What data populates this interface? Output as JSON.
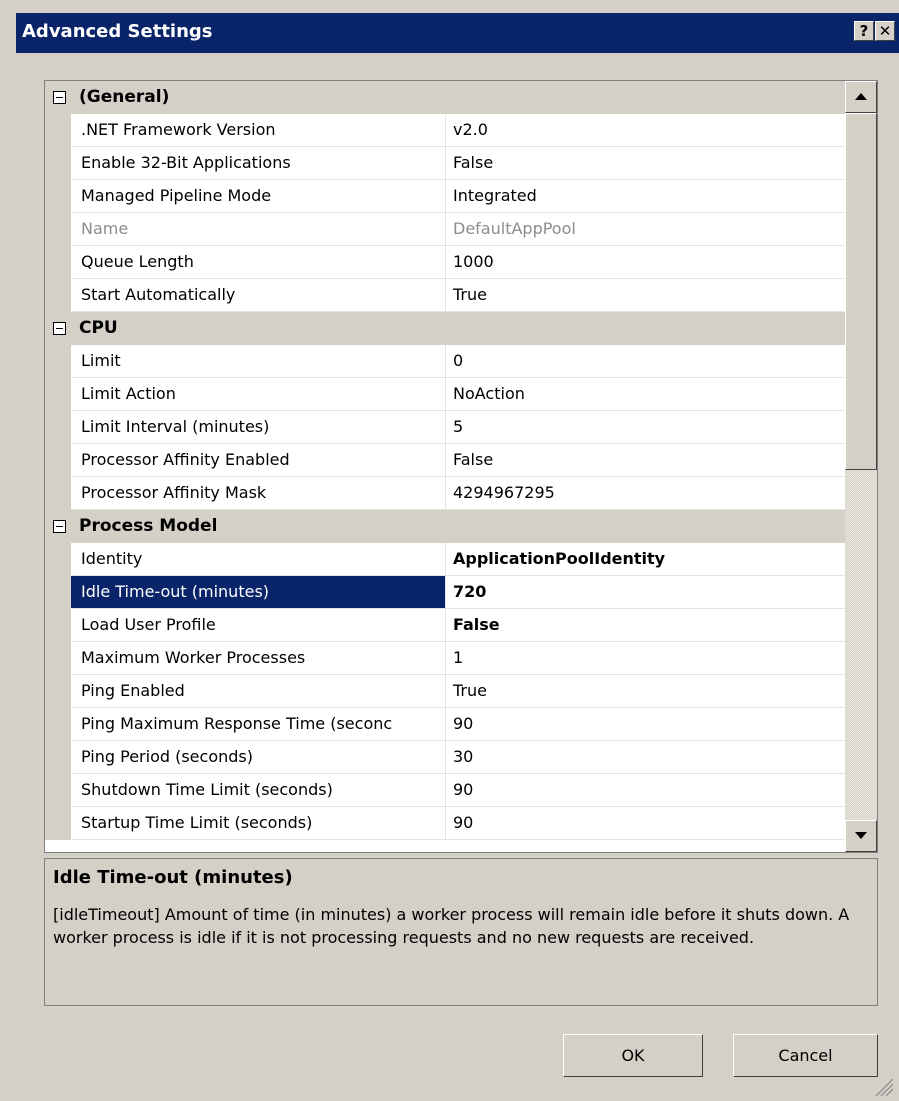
{
  "window": {
    "title": "Advanced Settings",
    "help_label": "?",
    "close_label": "✕"
  },
  "property_grid": {
    "categories": [
      {
        "name": "(General)",
        "properties": [
          {
            "name": ".NET Framework Version",
            "value": "v2.0"
          },
          {
            "name": "Enable 32-Bit Applications",
            "value": "False"
          },
          {
            "name": "Managed Pipeline Mode",
            "value": "Integrated"
          },
          {
            "name": "Name",
            "value": "DefaultAppPool",
            "disabled": true
          },
          {
            "name": "Queue Length",
            "value": "1000"
          },
          {
            "name": "Start Automatically",
            "value": "True"
          }
        ]
      },
      {
        "name": "CPU",
        "properties": [
          {
            "name": "Limit",
            "value": "0"
          },
          {
            "name": "Limit Action",
            "value": "NoAction"
          },
          {
            "name": "Limit Interval (minutes)",
            "value": "5"
          },
          {
            "name": "Processor Affinity Enabled",
            "value": "False"
          },
          {
            "name": "Processor Affinity Mask",
            "value": "4294967295"
          }
        ]
      },
      {
        "name": "Process Model",
        "properties": [
          {
            "name": "Identity",
            "value": "ApplicationPoolIdentity",
            "bold": true
          },
          {
            "name": "Idle Time-out (minutes)",
            "value": "720",
            "bold": true,
            "selected": true
          },
          {
            "name": "Load User Profile",
            "value": "False",
            "bold": true
          },
          {
            "name": "Maximum Worker Processes",
            "value": "1"
          },
          {
            "name": "Ping Enabled",
            "value": "True"
          },
          {
            "name": "Ping Maximum Response Time (seconc",
            "value": "90"
          },
          {
            "name": "Ping Period (seconds)",
            "value": "30"
          },
          {
            "name": "Shutdown Time Limit (seconds)",
            "value": "90"
          },
          {
            "name": "Startup Time Limit (seconds)",
            "value": "90"
          }
        ]
      }
    ]
  },
  "description": {
    "title": "Idle Time-out (minutes)",
    "text": "[idleTimeout] Amount of time (in minutes) a worker process will remain idle before it shuts down. A worker process is idle if it is not processing requests and no new requests are received."
  },
  "buttons": {
    "ok": "OK",
    "cancel": "Cancel"
  }
}
